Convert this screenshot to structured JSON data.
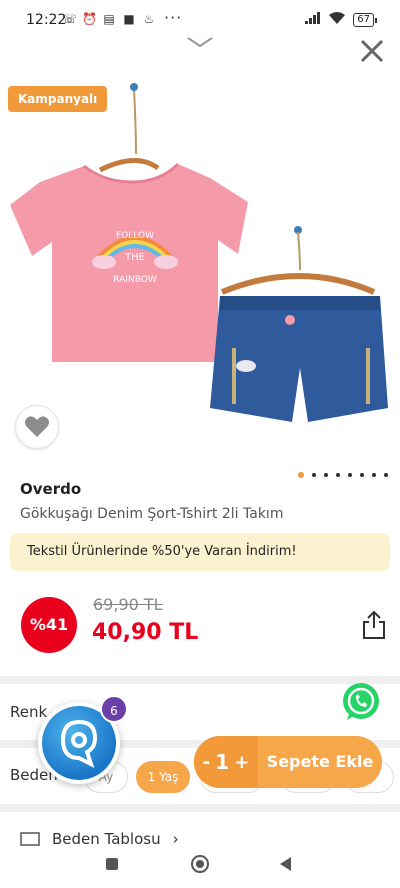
{
  "status_bar": {
    "time": "12:22",
    "battery": "67",
    "icons_left": [
      "missed-call-icon",
      "alarm-icon",
      "notes-icon",
      "tiktok-icon",
      "drop-icon"
    ],
    "more": "···"
  },
  "badge": {
    "campaign": "Kampanyalı"
  },
  "product": {
    "brand": "Overdo",
    "name": "Gökkuşağı Denim Şort-Tshirt 2li Takım",
    "shirt_print_line1": "FOLLOW",
    "shirt_print_line2": "THE",
    "shirt_print_line3": "RAINBOW"
  },
  "gallery": {
    "page_count": 8,
    "active_page": 1
  },
  "promo": {
    "text": "Tekstil Ürünlerinde %50'ye Varan İndirim!"
  },
  "price": {
    "discount": "%41",
    "old": "69,90 TL",
    "new": "40,90 TL"
  },
  "options": {
    "color_label": "Renk",
    "size_label": "Beden",
    "sizes": [
      "Ay",
      "1 Yaş",
      "",
      "",
      "ş"
    ],
    "selected_size": "1 Yaş"
  },
  "chat": {
    "badge_count": "6"
  },
  "cart": {
    "minus": "-",
    "quantity": "1",
    "plus": "+",
    "add_label": "Sepete Ekle"
  },
  "size_table": {
    "label": "Beden Tablosu"
  },
  "colors": {
    "accent": "#f29a3a",
    "price_red": "#e8001d",
    "promo_bg": "#fdf2cf",
    "chat_blue": "#1976c8",
    "whatsapp_green": "#25d366"
  }
}
